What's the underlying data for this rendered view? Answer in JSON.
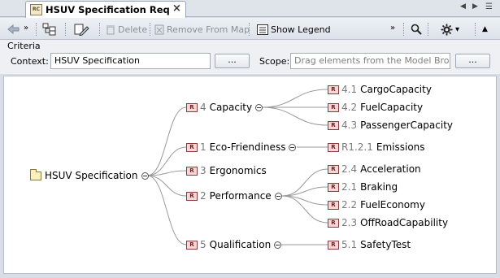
{
  "tab": {
    "icon_text": "RC",
    "title": "HSUV Specification Requi...",
    "close": "×"
  },
  "nav": {
    "prev": "◀",
    "next": "▶",
    "menu": "☰"
  },
  "toolbar": {
    "overflow": "»",
    "delete_label": "Delete",
    "remove_label": "Remove From Map",
    "show_legend_label": "Show Legend",
    "settings_dropdown": "▾",
    "collapse_up": "▲"
  },
  "criteria": {
    "title": "Criteria",
    "context_label": "Context:",
    "context_value": "HSUV Specification",
    "context_button": "...",
    "scope_label": "Scope:",
    "scope_placeholder": "Drag elements from the Model Browser",
    "scope_button": "..."
  },
  "map": {
    "root": {
      "label": "HSUV Specification"
    },
    "r_badge": "R",
    "requirements": [
      {
        "num": "4",
        "name": "Capacity",
        "children": [
          {
            "num": "4.1",
            "name": "CargoCapacity"
          },
          {
            "num": "4.2",
            "name": "FuelCapacity"
          },
          {
            "num": "4.3",
            "name": "PassengerCapacity"
          }
        ]
      },
      {
        "num": "1",
        "name": "Eco-Friendiness",
        "children": [
          {
            "num": "R1.2.1",
            "name": "Emissions"
          }
        ]
      },
      {
        "num": "3",
        "name": "Ergonomics",
        "children": []
      },
      {
        "num": "2",
        "name": "Performance",
        "children": [
          {
            "num": "2.4",
            "name": "Acceleration"
          },
          {
            "num": "2.1",
            "name": "Braking"
          },
          {
            "num": "2.2",
            "name": "FuelEconomy"
          },
          {
            "num": "2.3",
            "name": "OffRoadCapability"
          }
        ]
      },
      {
        "num": "5",
        "name": "Qualification",
        "children": [
          {
            "num": "5.1",
            "name": "SafetyTest"
          }
        ]
      }
    ]
  },
  "colors": {
    "edge": "#9a9a9a",
    "requirement_badge": "#f6d6d6",
    "package": "#fbf0c0"
  }
}
